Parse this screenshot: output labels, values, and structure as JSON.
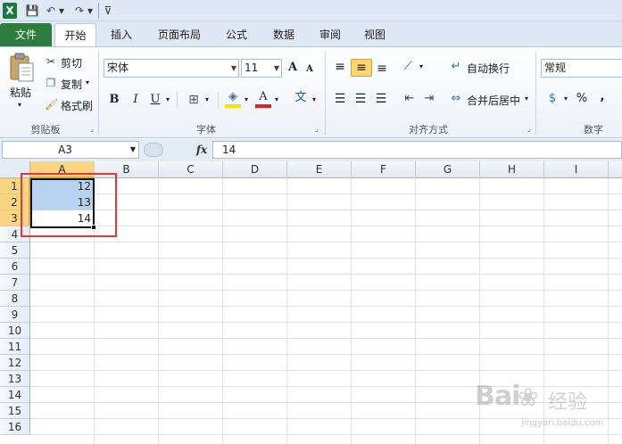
{
  "qat": {
    "logo": "X",
    "save_icon": "💾",
    "undo_icon": "↶",
    "redo_icon": "↷",
    "dropdown_icon": "▾",
    "customize_icon": "⊽"
  },
  "tabs": [
    "文件",
    "开始",
    "插入",
    "页面布局",
    "公式",
    "数据",
    "审阅",
    "视图"
  ],
  "ribbon": {
    "clipboard": {
      "paste": "粘贴",
      "cut": "剪切",
      "copy": "复制",
      "format_painter": "格式刷",
      "label": "剪贴板"
    },
    "font": {
      "name": "宋体",
      "size": "11",
      "grow": "A",
      "shrink": "A",
      "bold": "B",
      "italic": "I",
      "underline": "U",
      "font_color": "A",
      "phonetic": "文",
      "label": "字体"
    },
    "alignment": {
      "wrap_text": "自动换行",
      "merge_center": "合并后居中",
      "label": "对齐方式"
    },
    "number": {
      "format": "常规",
      "percent": "%",
      "comma": ",",
      "label": "数字"
    }
  },
  "formula_bar": {
    "name_box": "A3",
    "fx": "fx",
    "content": "14"
  },
  "sheet": {
    "columns": [
      "A",
      "B",
      "C",
      "D",
      "E",
      "F",
      "G",
      "H",
      "I"
    ],
    "rows": [
      "1",
      "2",
      "3",
      "4",
      "5",
      "6",
      "7",
      "8",
      "9",
      "10",
      "11",
      "12",
      "13",
      "14",
      "15",
      "16"
    ],
    "cells": {
      "A1": "12",
      "A2": "13",
      "A3": "14"
    }
  },
  "watermark": {
    "logo": "Bai",
    "text": "经验",
    "sub": "jingyan.baidu.com"
  },
  "colors": {
    "file_tab": "#2f7d3e",
    "selection_header": "#f9d581",
    "selected_cells": "#b8d3f0",
    "highlight_box": "#e23a3a"
  }
}
